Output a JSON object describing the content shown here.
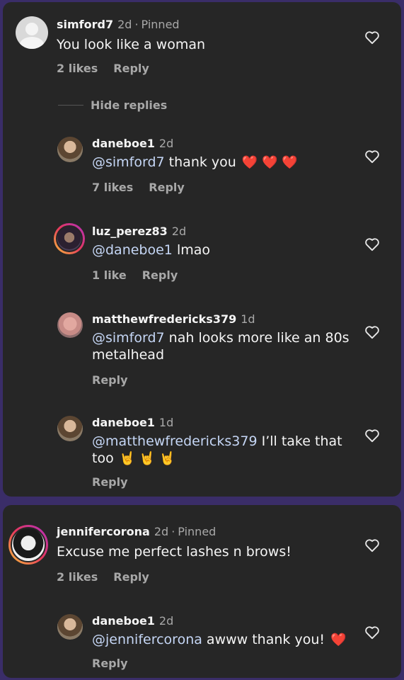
{
  "colors": {
    "background": "#3a2d68",
    "card": "#262626",
    "muted": "#a8a8a8",
    "mention": "#c5d6f5",
    "heart_emoji": "#e02424"
  },
  "thread1": {
    "top": {
      "username": "simford7",
      "time": "2d",
      "pinned": "Pinned",
      "text": "You look like a woman",
      "likes": "2 likes",
      "reply": "Reply"
    },
    "hide_replies": "Hide replies",
    "replies": [
      {
        "username": "daneboe1",
        "time": "2d",
        "mention": "@simford7",
        "text": " thank you ",
        "emoji": "❤️ ❤️ ❤️",
        "likes": "7 likes",
        "reply": "Reply"
      },
      {
        "username": "luz_perez83",
        "time": "2d",
        "mention": "@daneboe1",
        "text": " lmao",
        "likes": "1 like",
        "reply": "Reply"
      },
      {
        "username": "matthewfredericks379",
        "time": "1d",
        "mention": "@simford7",
        "text": " nah looks more like an 80s metalhead",
        "reply": "Reply"
      },
      {
        "username": "daneboe1",
        "time": "1d",
        "mention": "@matthewfredericks379",
        "text": " I’ll take that too ",
        "emoji": "🤘 🤘 🤘",
        "reply": "Reply"
      }
    ]
  },
  "thread2": {
    "top": {
      "username": "jennifercorona",
      "time": "2d",
      "pinned": "Pinned",
      "text": "Excuse me perfect lashes n brows!",
      "likes": "2 likes",
      "reply": "Reply"
    },
    "replies": [
      {
        "username": "daneboe1",
        "time": "2d",
        "mention": "@jennifercorona",
        "text": " awww thank you! ",
        "emoji": "❤️",
        "reply": "Reply"
      }
    ]
  }
}
